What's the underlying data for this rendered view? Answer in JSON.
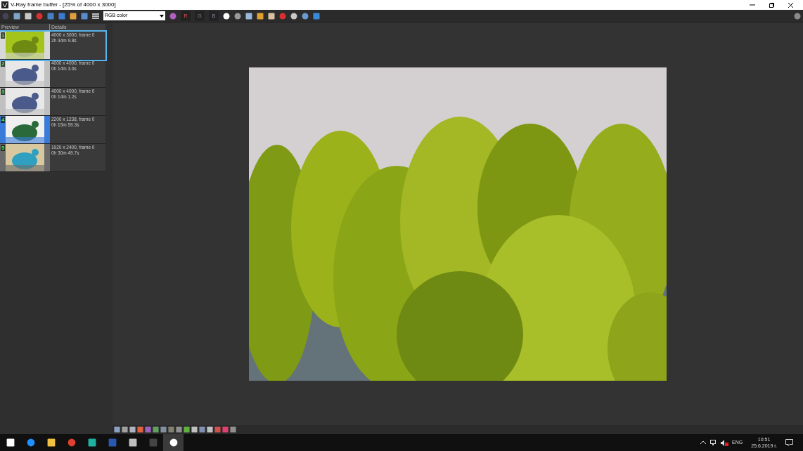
{
  "window": {
    "title": "V-Ray frame buffer - [25% of 4000 x 3000]"
  },
  "toolbar": {
    "channel": "RGB color",
    "channel_buttons": [
      "R",
      "G",
      "B"
    ]
  },
  "history": {
    "columns": [
      "Preview",
      "Details"
    ],
    "items": [
      {
        "number": "1",
        "size": "4000 x 3000, frame 0",
        "time": "2h 34m 9.8s",
        "selected": true
      },
      {
        "number": "2",
        "size": "4000 x 4000, frame 0",
        "time": "0h 14m 3.6s",
        "selected": false
      },
      {
        "number": "3",
        "size": "4000 x 4000, frame 0",
        "time": "0h 14m 1.2s",
        "selected": false
      },
      {
        "number": "4",
        "size": "2200 x 1238, frame 0",
        "time": "0h 15m 59.3s",
        "selected": false
      },
      {
        "number": "5",
        "size": "1920 x 2400, frame 0",
        "time": "0h 30m 49.7s",
        "selected": false
      }
    ]
  },
  "taskbar": {
    "language": "ENG",
    "time": "10:51",
    "date": "25.6.2019 г."
  }
}
